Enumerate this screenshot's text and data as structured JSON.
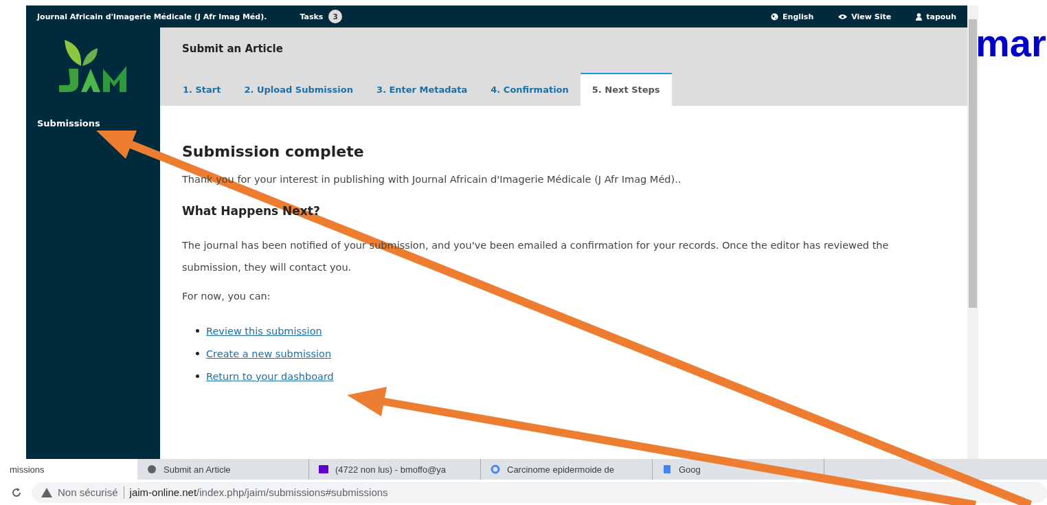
{
  "app": {
    "site_title": "Journal Africain d'Imagerie Médicale (J Afr Imag Méd).",
    "tasks_label": "Tasks",
    "tasks_count": "3",
    "user_menu": [
      {
        "kind": "language",
        "label": "English"
      },
      {
        "kind": "view",
        "label": "View Site"
      },
      {
        "kind": "user",
        "label": "tapouh"
      }
    ],
    "sidebar": {
      "items": [
        {
          "label": "Submissions",
          "selected": false
        }
      ]
    },
    "page_title": "Submit an Article",
    "tabs": [
      {
        "label": "1. Start",
        "selected": false
      },
      {
        "label": "2. Upload Submission",
        "selected": false
      },
      {
        "label": "3. Enter Metadata",
        "selected": false
      },
      {
        "label": "4. Confirmation",
        "selected": false
      },
      {
        "label": "5. Next Steps",
        "selected": true
      }
    ],
    "heading": "Submission complete",
    "thanks": "Thank you for your interest in publishing with Journal Africain d'Imagerie Médicale (J Afr Imag Méd)..",
    "subheading": "What Happens Next?",
    "notice": "The journal has been notified of your submission, and you've been emailed a confirmation for your records. Once the editor has reviewed the submission, they will contact you.",
    "for_now": "For now, you can:",
    "links": [
      "Review this submission",
      "Create a new submission",
      "Return to your dashboard"
    ]
  },
  "side_text": "mar",
  "browser": {
    "tabs": [
      {
        "label": "missions",
        "kind": "plain",
        "selected": true
      },
      {
        "label": "Submit an Article",
        "kind": "site",
        "selected": false
      },
      {
        "label": "(4722 non lus) - bmoffo@ya",
        "kind": "mail",
        "selected": false
      },
      {
        "label": "Carcinome epidermoide de",
        "kind": "search",
        "selected": false
      },
      {
        "label": "Goog",
        "kind": "doc",
        "selected": false
      }
    ],
    "security": "Non sécurisé",
    "url_host": "jaim-online.net",
    "url_path": "/index.php/jaim/submissions#submissions"
  }
}
